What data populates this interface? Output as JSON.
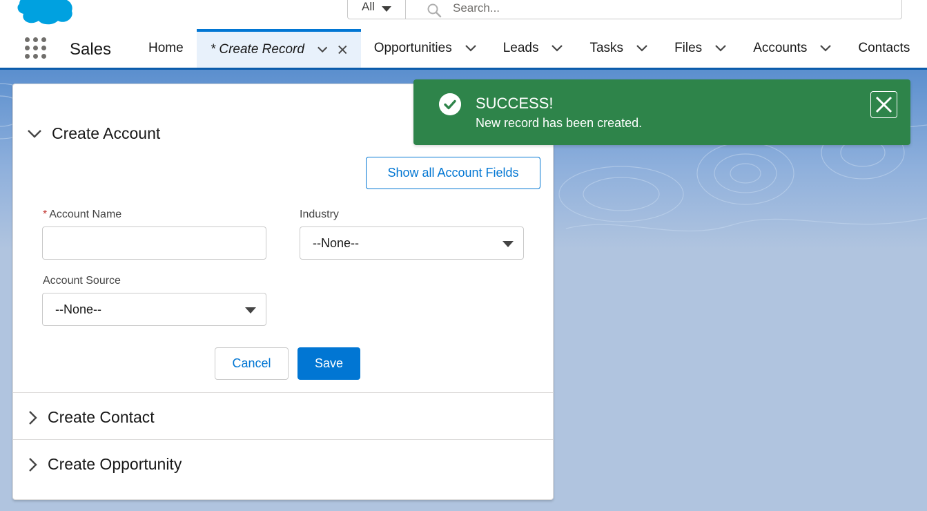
{
  "header": {
    "search_scope": "All",
    "search_placeholder": "Search..."
  },
  "nav": {
    "app_name": "Sales",
    "tabs": [
      {
        "label": "Home"
      },
      {
        "label": "* Create Record"
      },
      {
        "label": "Opportunities"
      },
      {
        "label": "Leads"
      },
      {
        "label": "Tasks"
      },
      {
        "label": "Files"
      },
      {
        "label": "Accounts"
      },
      {
        "label": "Contacts"
      }
    ]
  },
  "form": {
    "sections": {
      "account": "Create Account",
      "contact": "Create Contact",
      "opportunity": "Create Opportunity"
    },
    "show_fields_label": "Show all Account Fields",
    "account_name_label": "Account Name",
    "account_name_required": "*",
    "account_name_value": "",
    "industry_label": "Industry",
    "industry_value": "--None--",
    "account_source_label": "Account Source",
    "account_source_value": "--None--",
    "cancel_label": "Cancel",
    "save_label": "Save"
  },
  "toast": {
    "title": "SUCCESS!",
    "message": "New record has been created.",
    "status": "success"
  },
  "colors": {
    "brand": "#0176d3",
    "nav_underline": "#0b5cab",
    "success": "#2e844a",
    "background": "#b0c4df"
  }
}
